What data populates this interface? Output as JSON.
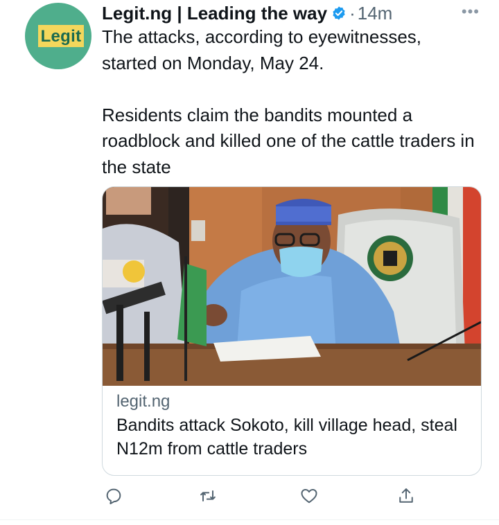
{
  "tweet": {
    "avatar_text": "Legit",
    "author_name": "Legit.ng | Leading the way",
    "separator": "·",
    "timestamp": "14m",
    "more_label": "•••",
    "text_para1": "The attacks, according to eyewitnesses, started on Monday, May 24.",
    "text_para2": "Residents claim the bandits mounted a roadblock and killed one of the cattle traders in the state"
  },
  "card": {
    "domain": "legit.ng",
    "title": "Bandits attack Sokoto, kill village head, steal N12m from cattle traders"
  },
  "actions": [
    {
      "name": "reply",
      "icon": "speech-bubble-icon"
    },
    {
      "name": "retweet",
      "icon": "retweet-icon"
    },
    {
      "name": "like",
      "icon": "heart-icon"
    },
    {
      "name": "share",
      "icon": "share-icon"
    }
  ],
  "colors": {
    "avatar_bg": "#4fae8c",
    "avatar_logo_bg": "#f4d75c",
    "verified_blue": "#1d9bf0",
    "muted_text": "#536471",
    "border": "#cfd9de"
  }
}
